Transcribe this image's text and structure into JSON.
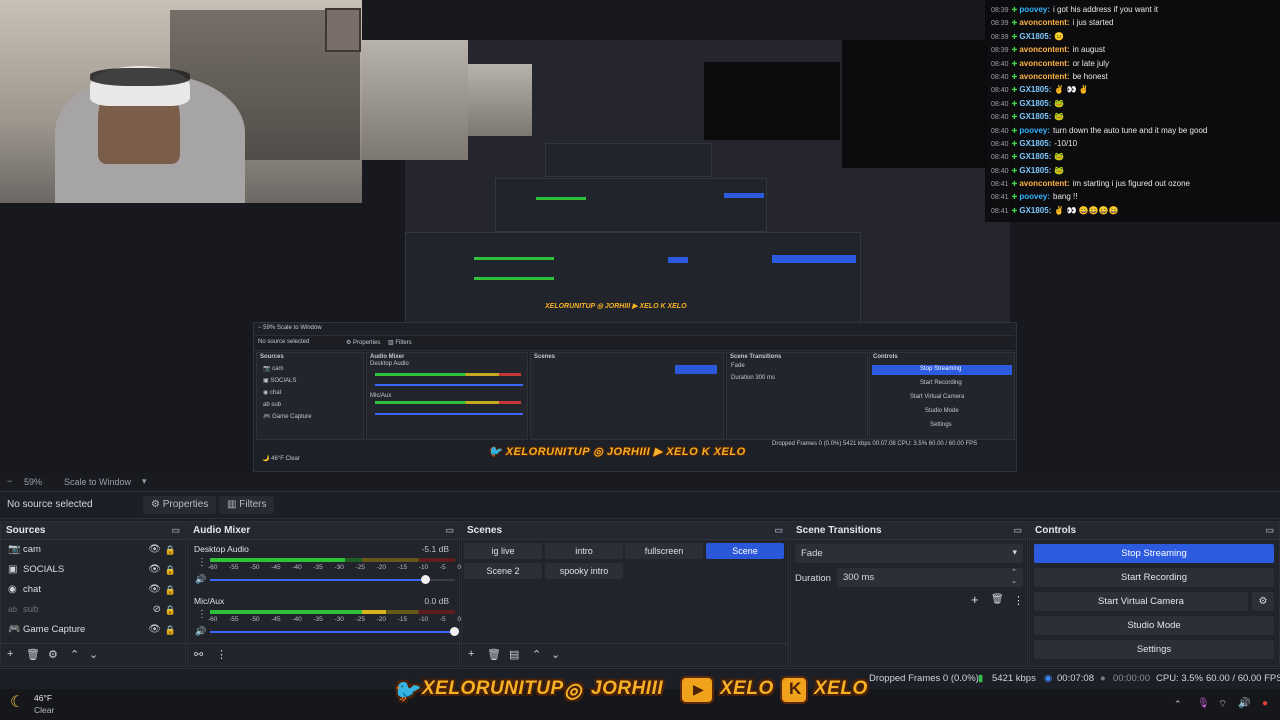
{
  "chat": {
    "lines": [
      {
        "time": "08:39",
        "user": "poovey:",
        "color": "#34b4ff",
        "msg": "i got his address if you want it"
      },
      {
        "time": "08:39",
        "user": "avoncontent:",
        "color": "#ffb347",
        "msg": "i jus started"
      },
      {
        "time": "08:39",
        "user": "GX1805:",
        "color": "#7ec8ff",
        "msg": "😐"
      },
      {
        "time": "08:39",
        "user": "avoncontent:",
        "color": "#ffb347",
        "msg": "in august"
      },
      {
        "time": "08:40",
        "user": "avoncontent:",
        "color": "#ffb347",
        "msg": "or late july"
      },
      {
        "time": "08:40",
        "user": "avoncontent:",
        "color": "#ffb347",
        "msg": "be honest"
      },
      {
        "time": "08:40",
        "user": "GX1805:",
        "color": "#7ec8ff",
        "msg": "✌ 👀 ✌"
      },
      {
        "time": "08:40",
        "user": "GX1805:",
        "color": "#7ec8ff",
        "msg": "🐸"
      },
      {
        "time": "08:40",
        "user": "GX1805:",
        "color": "#7ec8ff",
        "msg": "🐸"
      },
      {
        "time": "08:40",
        "user": "poovey:",
        "color": "#34b4ff",
        "msg": "turn down the auto tune and it may be good"
      },
      {
        "time": "08:40",
        "user": "GX1805:",
        "color": "#7ec8ff",
        "msg": "-10/10"
      },
      {
        "time": "08:40",
        "user": "GX1805:",
        "color": "#7ec8ff",
        "msg": "🐸"
      },
      {
        "time": "08:40",
        "user": "GX1805:",
        "color": "#7ec8ff",
        "msg": "🐸"
      },
      {
        "time": "08:41",
        "user": "avoncontent:",
        "color": "#ffb347",
        "msg": "im starting i jus figured out ozone"
      },
      {
        "time": "08:41",
        "user": "poovey:",
        "color": "#34b4ff",
        "msg": "bang !!"
      },
      {
        "time": "08:41",
        "user": "GX1805:",
        "color": "#7ec8ff",
        "msg": "✌ 👀 😀😀😀😀"
      }
    ]
  },
  "zoom": {
    "level": "59%",
    "mode": "Scale to Window"
  },
  "source_bar": {
    "no_source": "No source selected",
    "properties": "Properties",
    "filters": "Filters"
  },
  "sources": {
    "title": "Sources",
    "items": [
      {
        "name": "cam",
        "icon": "camera-icon"
      },
      {
        "name": "SOCIALS",
        "icon": "image-icon"
      },
      {
        "name": "chat",
        "icon": "browser-icon"
      },
      {
        "name": "sub",
        "icon": "text-icon"
      },
      {
        "name": "Game Capture",
        "icon": "gamepad-icon"
      }
    ]
  },
  "mixer": {
    "title": "Audio Mixer",
    "channels": [
      {
        "name": "Desktop Audio",
        "db": "-5.1 dB",
        "level": 0.55,
        "volume": 0.88
      },
      {
        "name": "Mic/Aux",
        "db": "0.0 dB",
        "level": 0.72,
        "volume": 1.0
      }
    ],
    "scale": [
      "-60",
      "-55",
      "-50",
      "-45",
      "-40",
      "-35",
      "-30",
      "-25",
      "-20",
      "-15",
      "-10",
      "-5",
      "0"
    ]
  },
  "scenes": {
    "title": "Scenes",
    "items": [
      "ig live",
      "intro",
      "fullscreen",
      "Scene",
      "Scene 2",
      "spooky intro"
    ],
    "active": "Scene"
  },
  "transitions": {
    "title": "Scene Transitions",
    "type": "Fade",
    "duration_label": "Duration",
    "duration": "300 ms"
  },
  "controls": {
    "title": "Controls",
    "stop_streaming": "Stop Streaming",
    "start_recording": "Start Recording",
    "start_virtual_camera": "Start Virtual Camera",
    "studio_mode": "Studio Mode",
    "settings": "Settings"
  },
  "status": {
    "dropped": "Dropped Frames 0 (0.0%)",
    "bitrate": "5421 kbps",
    "stream_time": "00:07:08",
    "rec_time": "00:00:00",
    "cpu": "CPU: 3.5%",
    "fps": "60.00 / 60.00 FPS"
  },
  "weather": {
    "temp": "46°F",
    "cond": "Clear"
  },
  "banner": {
    "twitter": "XELORUNITUP",
    "instagram": "JORHIII",
    "youtube": "XELO",
    "kick": "XELO"
  },
  "colors": {
    "accent": "#2d5be0",
    "orange": "#f1a21b"
  }
}
